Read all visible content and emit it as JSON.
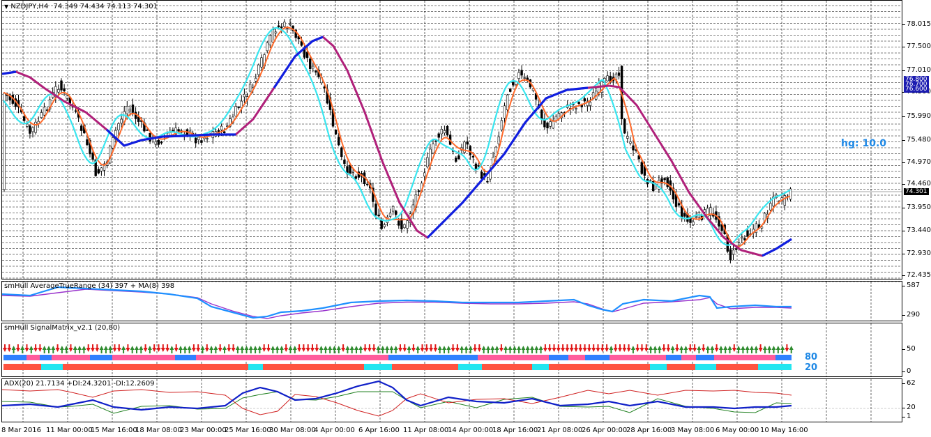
{
  "main": {
    "header": {
      "dropdown_icon": "triangle-down-icon",
      "symbol": "NZDJPY,H4",
      "ohlc": "74.349 74.434 74.113 74.301"
    },
    "price_ticks": [
      "78.015",
      "77.500",
      "77.010",
      "76.500",
      "75.990",
      "75.480",
      "74.970",
      "74.460",
      "73.950",
      "73.440",
      "72.930",
      "72.435"
    ],
    "price_tags": [
      "76.800",
      "76.700",
      "76.600"
    ],
    "current_price": "74.301",
    "hg_label": "hg: 10.0",
    "colors": {
      "ma_orange": "#ff6a2a",
      "ma_cyan": "#38e6f0",
      "ma_blue": "#1020e0",
      "ma_magenta": "#b0207a",
      "tag_blue": "#1c1cb0"
    }
  },
  "atr": {
    "title": "smHull AverageTrueRange (34) 397 + MA(8) 398",
    "ticks": [
      "587",
      "290"
    ],
    "colors": {
      "line": "#1e90ff",
      "ma": "#9933cc"
    }
  },
  "signal": {
    "title": "smHull SignalMatrix_v2.1 (20,80)",
    "ticks": [
      "50",
      "0"
    ],
    "level_high": "80",
    "level_low": "20",
    "colors": {
      "up": "#2e8b2e",
      "down": "#e01818",
      "pink": "#ff5c9c",
      "blue": "#2f80ff",
      "red": "#ff5340",
      "cyan": "#22e6f0",
      "label": "#1e88e5"
    }
  },
  "adx": {
    "title": "ADX(20) 21.7134 +DI:24.3201 -DI:12.2609",
    "ticks": [
      "62",
      "20",
      "1"
    ],
    "colors": {
      "adx": "#1020c8",
      "plus_di": "#208020",
      "minus_di": "#d02020"
    }
  },
  "x_labels": [
    "8 Mar 2016",
    "11 Mar 00:00",
    "15 Mar 16:00",
    "18 Mar 08:00",
    "23 Mar 00:00",
    "25 Mar 16:00",
    "30 Mar 08:00",
    "4 Apr 00:00",
    "6 Apr 16:00",
    "11 Apr 08:00",
    "14 Apr 00:00",
    "18 Apr 16:00",
    "21 Apr 08:00",
    "26 Apr 00:00",
    "28 Apr 16:00",
    "3 May 08:00",
    "6 May 00:00",
    "10 May 16:00"
  ]
}
